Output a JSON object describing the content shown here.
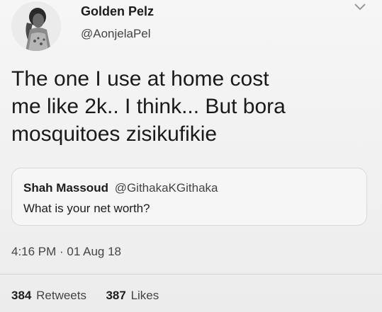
{
  "author": {
    "name": "Golden Pelz",
    "handle": "@AonjelaPel"
  },
  "tweet": {
    "lines": [
      "The one I use at home cost",
      "me like 2k.. I think... But bora",
      "mosquitoes zisikufikie"
    ]
  },
  "quoted_tweet": {
    "name": "Shah Massoud",
    "handle": "@GithakaKGithaka",
    "text": "What is your net worth?"
  },
  "meta": {
    "timestamp": "4:16 PM · 01 Aug 18"
  },
  "stats": {
    "retweets_count": "384",
    "retweets_label": "Retweets",
    "likes_count": "387",
    "likes_label": "Likes"
  },
  "icons": {
    "menu": "chevron-down-icon",
    "avatar": "profile-photo"
  }
}
